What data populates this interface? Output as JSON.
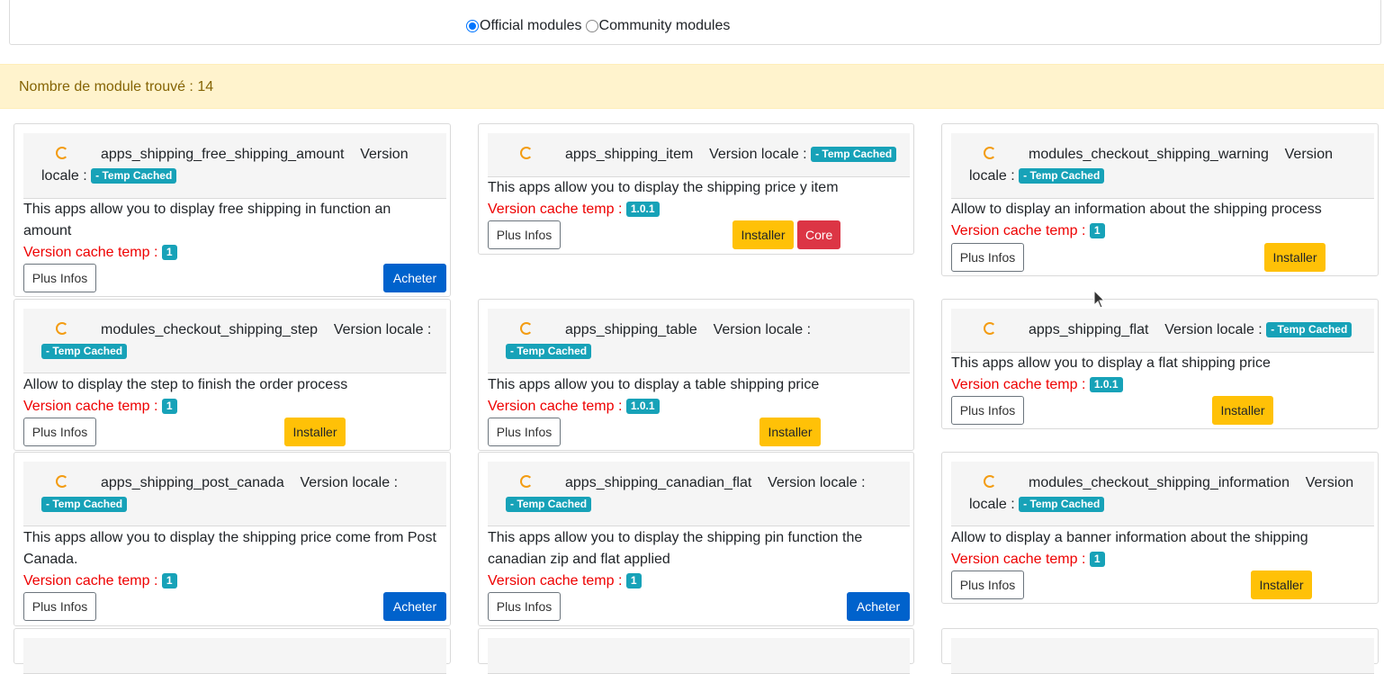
{
  "filter": {
    "official_label": "Official modules",
    "community_label": "Community modules"
  },
  "alert": {
    "text": "Nombre de module trouvé : 14"
  },
  "labels": {
    "version_locale": "Version locale :",
    "version_locale_a": "Version",
    "version_locale_b": "locale :",
    "version_cache": "Version cache temp :",
    "temp_cached": "- Temp Cached",
    "plus_infos": "Plus Infos",
    "acheter": "Acheter",
    "installer": "Installer",
    "core": "Core"
  },
  "modules": [
    {
      "name": "apps_shipping_free_shipping_amount",
      "description": "This apps allow you to display free shipping in function an amount",
      "cache_version": "1"
    },
    {
      "name": "apps_shipping_item",
      "description": "This apps allow you to display the shipping price y item",
      "cache_version": "1.0.1"
    },
    {
      "name": "modules_checkout_shipping_warning",
      "description": "Allow to display an information about the shipping process",
      "cache_version": "1"
    },
    {
      "name": "modules_checkout_shipping_step",
      "description": "Allow to display the step to finish the order process",
      "cache_version": "1"
    },
    {
      "name": "apps_shipping_table",
      "description": "This apps allow you to display a table shipping price",
      "cache_version": "1.0.1"
    },
    {
      "name": "apps_shipping_flat",
      "description": "This apps allow you to display a flat shipping price",
      "cache_version": "1.0.1"
    },
    {
      "name": "apps_shipping_post_canada",
      "description": "This apps allow you to display the shipping price come from Post Canada.",
      "cache_version": "1"
    },
    {
      "name": "apps_shipping_canadian_flat",
      "description": "This apps allow you to display the shipping pin function the canadian zip and flat applied",
      "cache_version": "1"
    },
    {
      "name": "modules_checkout_shipping_information",
      "description": "Allow to display a banner information about the shipping",
      "cache_version": "1"
    }
  ]
}
